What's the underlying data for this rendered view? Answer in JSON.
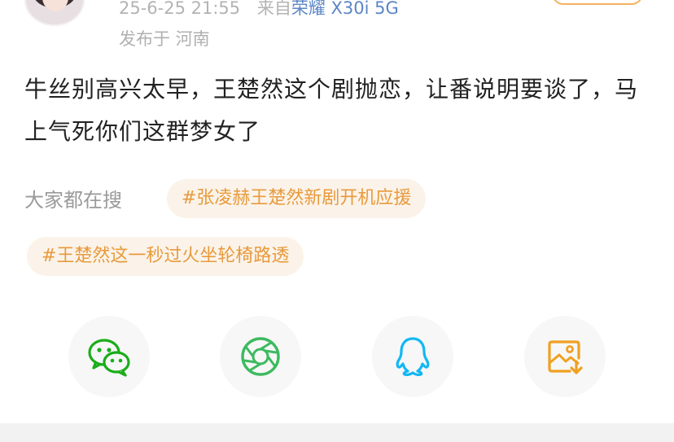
{
  "post": {
    "timestamp": "25-6-25 21:55",
    "source_prefix": "来自",
    "device": "荣耀 X30i 5G",
    "location": "发布于 河南",
    "text": "牛丝别高兴太早，王楚然这个剧抛恋，让番说明要谈了，马上气死你们这群梦女了"
  },
  "trending": {
    "label": "大家都在搜",
    "tags": [
      "#张凌赫王楚然新剧开机应援",
      "#王楚然这一秒过火坐轮椅路透"
    ]
  },
  "share": {
    "icons": [
      "wechat-icon",
      "moments-icon",
      "qq-icon",
      "save-image-icon"
    ]
  },
  "colors": {
    "accent": "#e89a3c",
    "tag_bg": "#fbf3e9",
    "wechat": "#1aad19",
    "qq": "#12b7f5",
    "moments": "#3cba5f"
  }
}
